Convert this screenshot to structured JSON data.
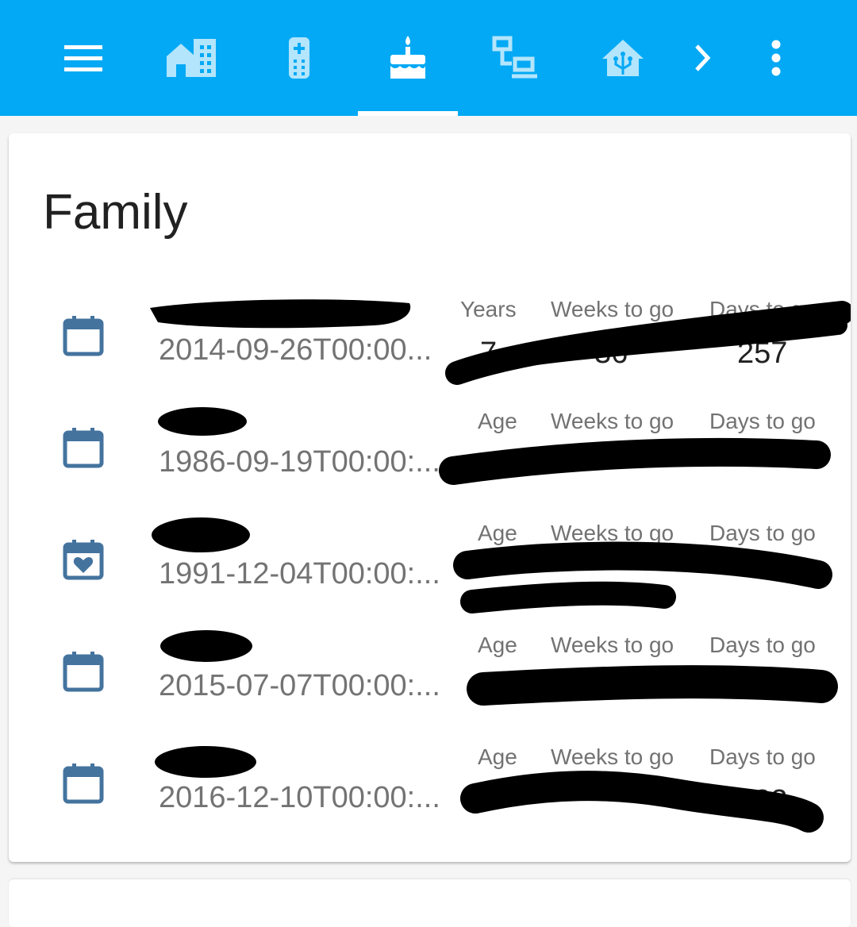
{
  "topbar": {
    "accent_color": "#03a9f4",
    "icons": [
      "menu-icon",
      "city-icon",
      "remote-icon",
      "cake-icon",
      "lan-icon",
      "home-assistant-icon",
      "chevron-right-icon",
      "dots-vertical-icon"
    ]
  },
  "card": {
    "title": "Family",
    "rows": [
      {
        "icon": "calendar-icon",
        "name": "",
        "date": "2014-09-26T00:00...",
        "labels": [
          "Years",
          "Weeks to go",
          "Days to go"
        ],
        "values": [
          "7",
          "36",
          "257"
        ]
      },
      {
        "icon": "calendar-icon",
        "name": "",
        "date": "1986-09-19T00:00:...",
        "labels": [
          "Age",
          "Weeks to go",
          "Days to go"
        ],
        "values": [
          "",
          "",
          ""
        ]
      },
      {
        "icon": "calendar-heart-icon",
        "name": "",
        "date": "1991-12-04T00:00:...",
        "labels": [
          "Age",
          "Weeks to go",
          "Days to go"
        ],
        "values": [
          "",
          "",
          ""
        ]
      },
      {
        "icon": "calendar-icon",
        "name": "",
        "date": "2015-07-07T00:00:...",
        "labels": [
          "Age",
          "Weeks to go",
          "Days to go"
        ],
        "values": [
          "",
          "",
          ""
        ]
      },
      {
        "icon": "calendar-icon",
        "name": "",
        "date": "2016-12-10T00:00:...",
        "labels": [
          "Age",
          "Weeks to go",
          "Days to go"
        ],
        "values": [
          "",
          "",
          "332"
        ]
      }
    ]
  }
}
